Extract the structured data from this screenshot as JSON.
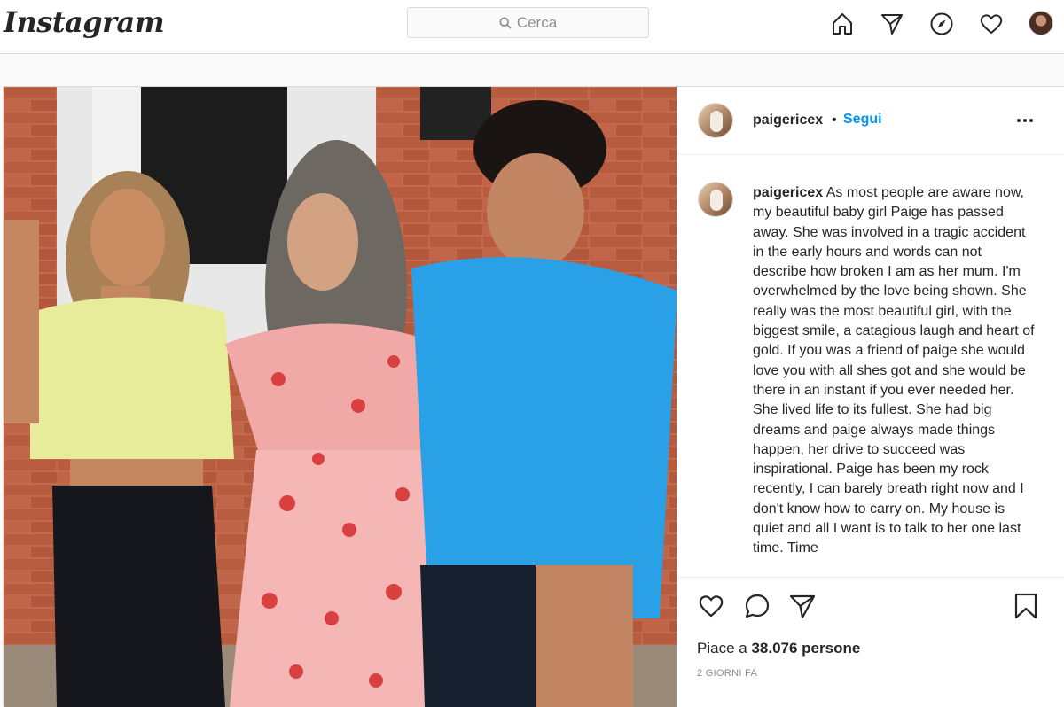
{
  "app": {
    "logo": "Instagram"
  },
  "search": {
    "placeholder": "Cerca"
  },
  "nav": {
    "icons": [
      "home-icon",
      "direct-icon",
      "explore-icon",
      "activity-icon",
      "profile-avatar"
    ]
  },
  "post": {
    "username": "paigericex",
    "separator": "•",
    "follow_label": "Segui",
    "more_label": "•••",
    "caption_user": "paigericex",
    "caption_text": " As most people are aware now, my beautiful baby girl Paige has passed away. She was involved in a tragic accident in the early hours and words can not describe how broken I am as her mum. I'm overwhelmed by the love being shown. She really was the most beautiful girl, with the biggest smile, a catagious laugh and heart of gold. If you was a friend of paige she would love you with all shes got and she would be there in an instant if you ever needed her. She lived life to its fullest. She had big dreams and paige always made things happen, her drive to succeed was inspirational. Paige has been my rock recently, I can barely breath right now and I don't know how to carry on. My house is quiet and all I want is to talk to her one last time. Time",
    "likes_prefix": "Piace a ",
    "likes_count": "38.076 persone",
    "time_ago": "2 GIORNI FA"
  },
  "colors": {
    "accent": "#0095f6",
    "text": "#262626",
    "muted": "#8e8e8e",
    "border": "#dbdbdb"
  }
}
